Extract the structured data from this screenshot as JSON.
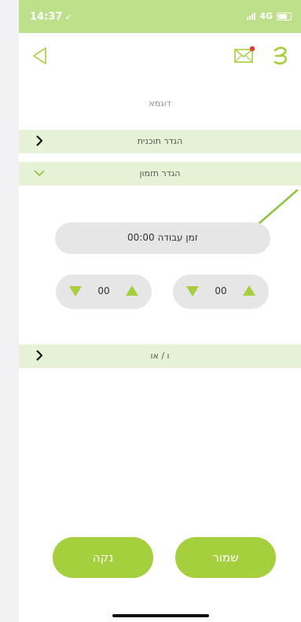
{
  "status_bar": {
    "time": "14:37",
    "location_glyph": "➶",
    "network": "4G"
  },
  "header": {
    "back_icon": "back-triangle-icon",
    "mail_icon": "mail-icon",
    "menu_icon": "menu-icon"
  },
  "page": {
    "title": "דוגמא"
  },
  "sections": {
    "program": {
      "label": "הגדר תוכנית"
    },
    "schedule": {
      "label": "הגדר תזמון"
    },
    "and_or": {
      "label": "ו / או"
    }
  },
  "schedule": {
    "work_time": "זמן עבודה 00:00",
    "spinner_left": "00",
    "spinner_right": "00"
  },
  "buttons": {
    "clear": "נקה",
    "save": "שמור"
  },
  "colors": {
    "accent": "#a6cf3d",
    "status_bar": "#bfe08a",
    "row_bg": "#e6f3d6",
    "arrow": "#8cc63f"
  }
}
